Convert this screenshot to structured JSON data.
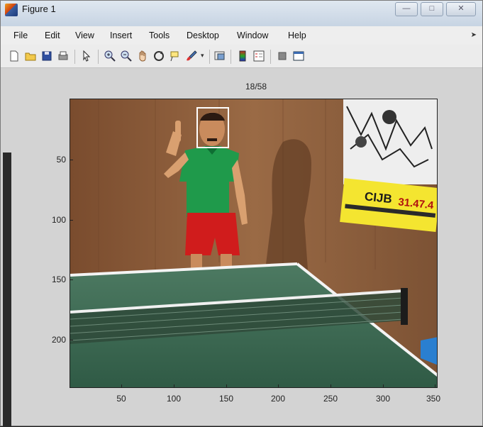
{
  "window": {
    "title": "Figure 1"
  },
  "window_controls": {
    "minimize": "—",
    "maximize": "□",
    "close": "✕"
  },
  "menu": {
    "items": [
      "File",
      "Edit",
      "View",
      "Insert",
      "Tools",
      "Desktop",
      "Window",
      "Help"
    ]
  },
  "toolbar": {
    "icons": [
      "new-figure-icon",
      "open-icon",
      "save-icon",
      "print-icon",
      "pointer-icon",
      "zoom-in-icon",
      "zoom-out-icon",
      "pan-icon",
      "rotate-icon",
      "data-cursor-icon",
      "brush-icon",
      "link-icon",
      "colorbar-icon",
      "legend-icon",
      "hide-tools-icon",
      "show-tools-icon"
    ]
  },
  "axes": {
    "title": "18/58",
    "y_ticks": [
      "50",
      "100",
      "150",
      "200"
    ],
    "x_ticks": [
      "50",
      "100",
      "150",
      "200",
      "250",
      "300",
      "350"
    ]
  },
  "image_content": {
    "poster_text": "CIJB",
    "poster_number": "31.47.4"
  },
  "colors": {
    "wall": "#8b5e3c",
    "table": "#3f6d55",
    "shirt": "#1f9a4b",
    "shorts": "#d01c1c",
    "face_box": "#ffffff"
  }
}
